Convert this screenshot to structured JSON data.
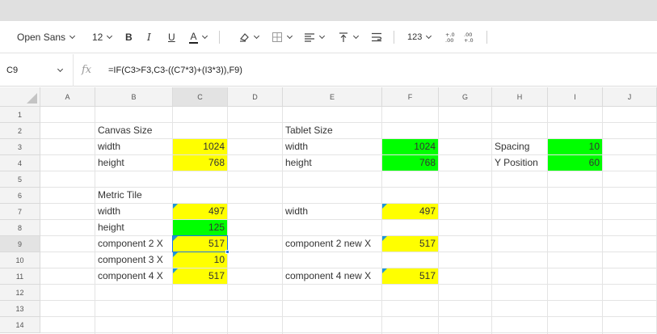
{
  "toolbar": {
    "font_family": "Open Sans",
    "font_size": "12",
    "bold_label": "B",
    "italic_label": "I",
    "underline_label": "U",
    "text_color_label": "A",
    "number_format": "123",
    "increase_decimals": "+.0\n.00",
    "decrease_decimals": ".00\n+.0"
  },
  "formula_bar": {
    "name_box": "C9",
    "fx_label": "fx",
    "formula": "=IF(C3>F3,C3-((C7*3)+(I3*3)),F9)"
  },
  "columns": [
    "A",
    "B",
    "C",
    "D",
    "E",
    "F",
    "G",
    "H",
    "I",
    "J"
  ],
  "rows": [
    "1",
    "2",
    "3",
    "4",
    "5",
    "6",
    "7",
    "8",
    "9",
    "10",
    "11",
    "12",
    "13",
    "14"
  ],
  "cells": {
    "B2": "Canvas Size",
    "B3": "width",
    "C3": "1024",
    "B4": "height",
    "C4": "768",
    "E2": "Tablet Size",
    "E3": "width",
    "F3": "1024",
    "E4": "height",
    "F4": "768",
    "H3": "Spacing",
    "I3": "10",
    "H4": "Y Position",
    "I4": "60",
    "B6": "Metric Tile",
    "B7": "width",
    "C7": "497",
    "E7": "width",
    "F7": "497",
    "B8": "height",
    "C8": "125",
    "B9": "component 2 X",
    "C9": "517",
    "E9": "component 2 new X",
    "F9": "517",
    "B10": "component 3 X",
    "C10": "10",
    "B11": "component 4 X",
    "C11": "517",
    "E11": "component 4 new X",
    "F11": "517"
  },
  "colors": {
    "yellow": "#ffff00",
    "green": "#00ff00",
    "selection": "#1a73e8",
    "note_marker": "#1f97d6"
  },
  "icons": [
    "chevron-down-icon",
    "clear-format-icon",
    "borders-icon",
    "align-left-icon",
    "vertical-align-top-icon",
    "wrap-text-icon",
    "increase-decimals-icon",
    "decrease-decimals-icon"
  ]
}
